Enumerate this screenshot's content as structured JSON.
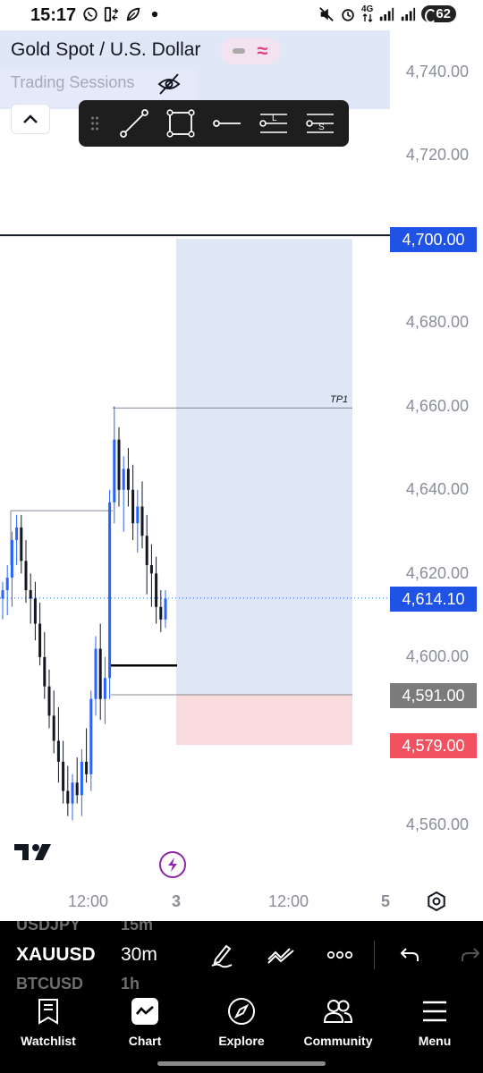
{
  "status_bar": {
    "time": "15:17",
    "battery": "62",
    "network": "4G"
  },
  "symbol": {
    "title": "Gold Spot / U.S. Dollar",
    "sessions_label": "Trading Sessions"
  },
  "drawing_toolbar": {
    "items": [
      "drag-handle",
      "trend-line",
      "rectangle",
      "horizontal-ray",
      "long-position",
      "short-position"
    ],
    "long_letter": "L",
    "short_letter": "S"
  },
  "price_axis": {
    "labels": [
      "4,740.00",
      "4,720.00",
      "4,680.00",
      "4,660.00",
      "4,640.00",
      "4,620.00",
      "4,600.00",
      "4,560.00"
    ]
  },
  "price_tags": [
    {
      "value": "4,700.00",
      "color": "#1e53e5"
    },
    {
      "value": "4,614.10",
      "color": "#1e53e5"
    },
    {
      "value": "4,591.00",
      "color": "#7b7b7b"
    },
    {
      "value": "4,579.00",
      "color": "#f2525f"
    }
  ],
  "chart": {
    "annotation_tp": "TP1",
    "last_price": 4614.1,
    "entry": 4591.0,
    "stop": 4579.0,
    "target": 4700.0,
    "horizontal_line": 4700.0,
    "up_color": "#2962ff",
    "down_color": "#131722",
    "profit_zone_color": "#dfe7f7",
    "loss_zone_color": "#fadbdd"
  },
  "time_axis": {
    "labels": [
      "12:00",
      "3",
      "12:00",
      "5"
    ]
  },
  "symbol_bar": {
    "ghost_above_symbol": "USDJPY",
    "ghost_above_interval": "15m",
    "symbol": "XAUUSD",
    "interval": "30m",
    "ghost_below_symbol": "BTCUSD",
    "ghost_below_interval": "1h"
  },
  "bottom_nav": {
    "items": [
      {
        "label": "Watchlist",
        "icon": "watchlist-icon"
      },
      {
        "label": "Chart",
        "icon": "chart-icon"
      },
      {
        "label": "Explore",
        "icon": "compass-icon"
      },
      {
        "label": "Community",
        "icon": "community-icon"
      },
      {
        "label": "Menu",
        "icon": "menu-icon"
      }
    ]
  }
}
